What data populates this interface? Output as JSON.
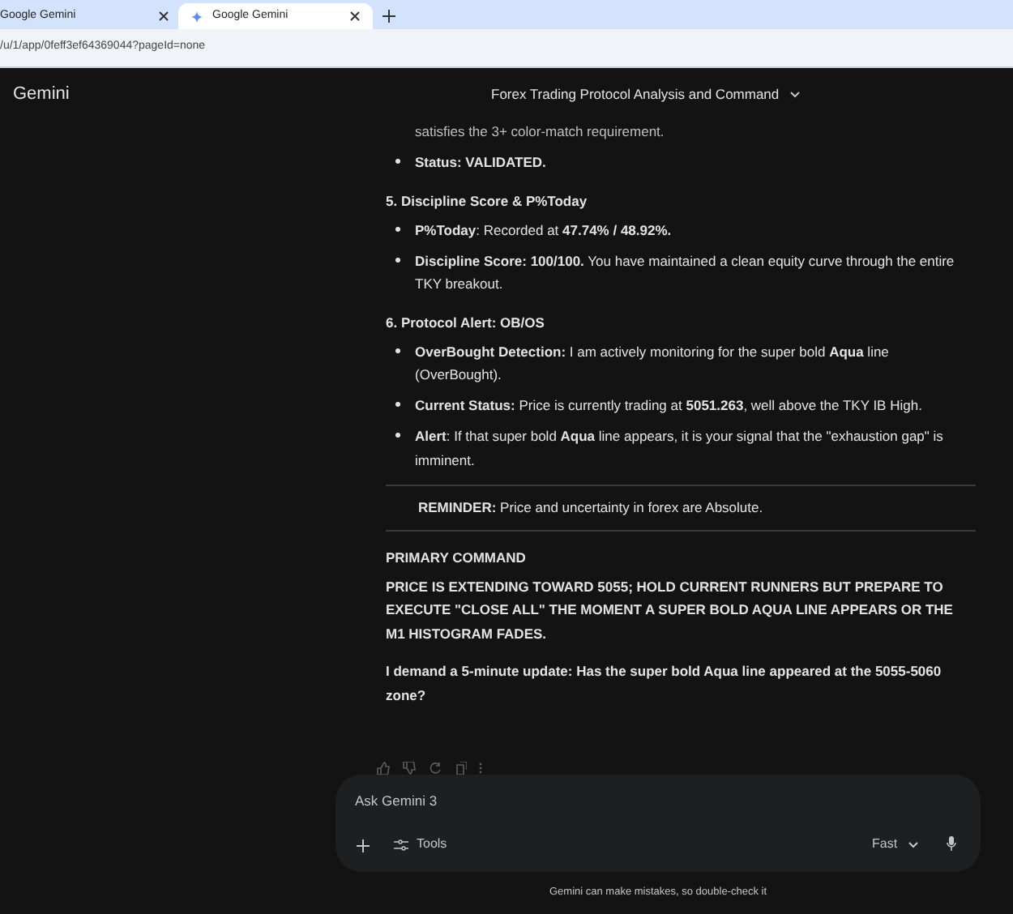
{
  "browser": {
    "tabs": [
      {
        "label": "Google Gemini",
        "selected": false
      },
      {
        "label": "Google Gemini",
        "selected": true
      }
    ],
    "address": "/u/1/app/0feff3ef64369044?pageId=none"
  },
  "app_name": "Gemini",
  "conversation_title": "Forex Trading Protocol Analysis and Command",
  "response": [
    {
      "kind": "continuation",
      "text": "satisfies the 3+ color-match requirement."
    },
    {
      "kind": "bullet",
      "text": "**Status: VALIDATED.**"
    },
    {
      "kind": "heading",
      "text": "5. Discipline Score & P%Today"
    },
    {
      "kind": "bullet",
      "text": "**P%Today**: Recorded at **47.74% / 48.92%.**"
    },
    {
      "kind": "bullet",
      "text": "**Discipline Score: 100/100.** You have maintained a clean equity curve through the entire TKY breakout."
    },
    {
      "kind": "heading",
      "text": "6. Protocol Alert: OB/OS"
    },
    {
      "kind": "bullet",
      "text": "**OverBought Detection:** I am actively monitoring for the super bold **Aqua** line (OverBought)."
    },
    {
      "kind": "bullet",
      "text": "**Current Status:** Price is currently trading at **5051.263**, well above the TKY IB High."
    },
    {
      "kind": "bullet",
      "text": "**Alert**: If that super bold **Aqua** line appears, it is your signal that the \"exhaustion gap\" is imminent."
    },
    {
      "kind": "quote",
      "text": "**REMINDER:** Price and uncertainty in forex are Absolute."
    },
    {
      "kind": "heading",
      "text": "PRIMARY COMMAND"
    },
    {
      "kind": "strong",
      "text": "PRICE IS EXTENDING TOWARD 5055; HOLD CURRENT RUNNERS BUT PREPARE TO EXECUTE \"CLOSE ALL\" THE MOMENT A SUPER BOLD AQUA LINE APPEARS OR THE M1 HISTOGRAM FADES."
    },
    {
      "kind": "strong",
      "text": "I demand a 5-minute update: Has the super bold Aqua line appeared at the 5055-5060 zone?"
    }
  ],
  "prompt": {
    "placeholder": "Ask Gemini 3",
    "tools": "Tools",
    "mode": "Fast"
  },
  "disclaimer": "Gemini can make mistakes, so double-check it"
}
